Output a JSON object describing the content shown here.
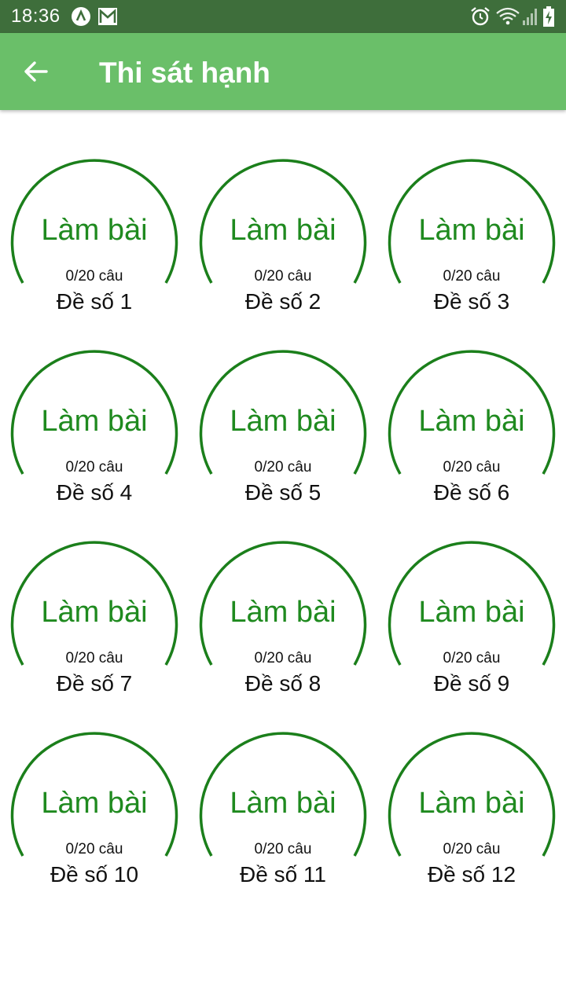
{
  "status_bar": {
    "time": "18:36",
    "left_icons": [
      "a-circle-icon",
      "mail-icon"
    ],
    "right_icons": [
      "alarm-icon",
      "wifi-icon",
      "signal-icon",
      "battery-charging-icon"
    ]
  },
  "app_bar": {
    "back_icon": "arrow-left-icon",
    "title": "Thi sát hạnh",
    "color": "#6abf69"
  },
  "exams": [
    {
      "action": "Làm bài",
      "progress": "0/20 câu",
      "label": "Đề số 1"
    },
    {
      "action": "Làm bài",
      "progress": "0/20 câu",
      "label": "Đề số 2"
    },
    {
      "action": "Làm bài",
      "progress": "0/20 câu",
      "label": "Đề số 3"
    },
    {
      "action": "Làm bài",
      "progress": "0/20 câu",
      "label": "Đề số 4"
    },
    {
      "action": "Làm bài",
      "progress": "0/20 câu",
      "label": "Đề số 5"
    },
    {
      "action": "Làm bài",
      "progress": "0/20 câu",
      "label": "Đề số 6"
    },
    {
      "action": "Làm bài",
      "progress": "0/20 câu",
      "label": "Đề số 7"
    },
    {
      "action": "Làm bài",
      "progress": "0/20 câu",
      "label": "Đề số 8"
    },
    {
      "action": "Làm bài",
      "progress": "0/20 câu",
      "label": "Đề số 9"
    },
    {
      "action": "Làm bài",
      "progress": "0/20 câu",
      "label": "Đề số 10"
    },
    {
      "action": "Làm bài",
      "progress": "0/20 câu",
      "label": "Đề số 11"
    },
    {
      "action": "Làm bài",
      "progress": "0/20 câu",
      "label": "Đề số 12"
    }
  ],
  "ring_color": "#1b7f1b"
}
